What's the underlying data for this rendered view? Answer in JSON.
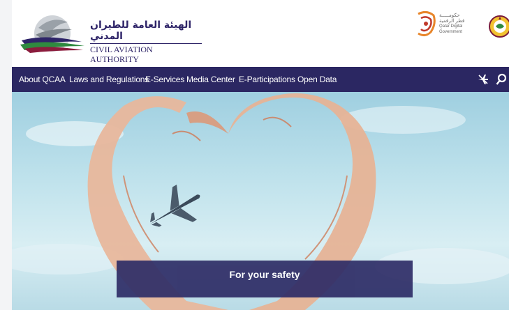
{
  "header": {
    "logo_arabic": "الهيئة العامة للطيران المدني",
    "logo_english": "CIVIL AVIATION AUTHORITY",
    "gov_logo_arabic_1": "حكومـــــة",
    "gov_logo_arabic_2": "قطر الرقمية",
    "gov_logo_english_1": "Qatar Digital",
    "gov_logo_english_2": "Government"
  },
  "nav": {
    "items": [
      {
        "label": "About QCAA"
      },
      {
        "label": "Laws and Regulations"
      },
      {
        "label": "E-Services"
      },
      {
        "label": "Media Center"
      },
      {
        "label": "E-Participations"
      },
      {
        "label": "Open Data"
      }
    ],
    "icons": [
      "flight-toggle-icon",
      "search-icon"
    ]
  },
  "hero": {
    "caption": "For your safety",
    "slides_total": 4,
    "active_slide": 1
  },
  "colors": {
    "nav_background": "#2b2762",
    "caption_background": "#2e2c66",
    "brand": "#2e2468"
  }
}
